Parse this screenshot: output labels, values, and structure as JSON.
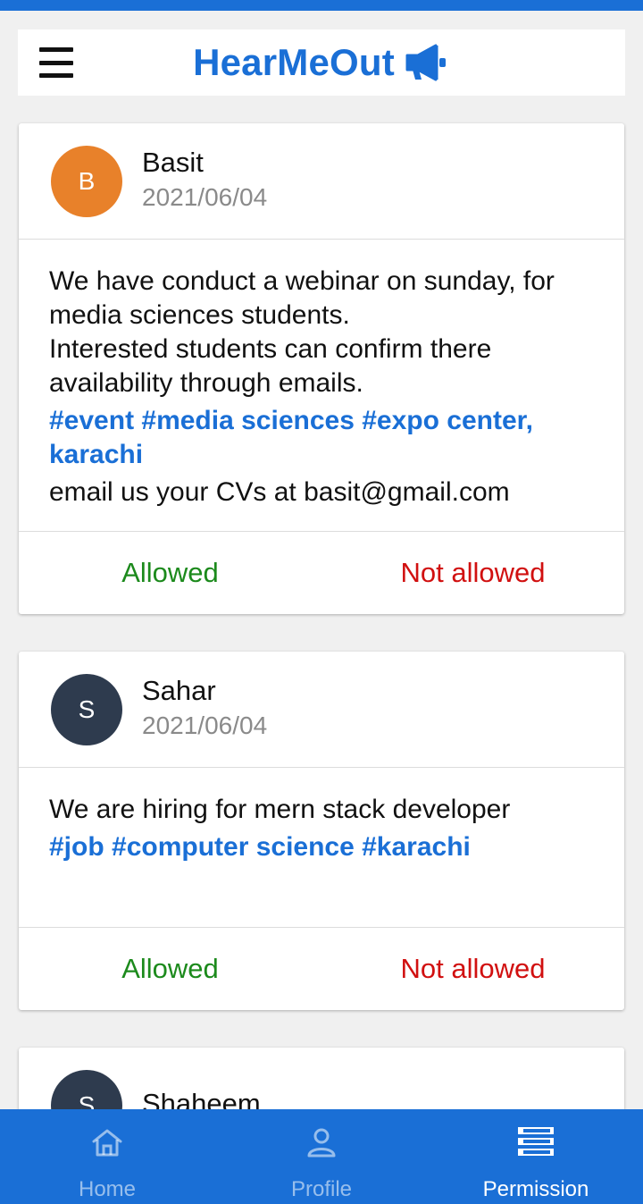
{
  "header": {
    "title": "HearMeOut",
    "icon": "megaphone-icon",
    "menu_icon": "hamburger-menu-icon"
  },
  "colors": {
    "primary": "#1a6fd6",
    "allowed": "#1c8a1c",
    "not_allowed": "#d11010"
  },
  "posts": [
    {
      "avatar_letter": "B",
      "avatar_color": "#e8812a",
      "author": "Basit",
      "date": "2021/06/04",
      "lines": [
        "We have conduct a webinar on sunday, for",
        "media sciences students.",
        "Interested students can confirm there",
        "availability through emails."
      ],
      "tags": "#event #media sciences #expo center, karachi",
      "footer_line": "email us your CVs at basit@gmail.com",
      "allow_label": "Allowed",
      "deny_label": "Not allowed"
    },
    {
      "avatar_letter": "S",
      "avatar_color": "#2e3b4e",
      "author": "Sahar",
      "date": "2021/06/04",
      "lines": [
        "We are hiring for mern stack developer"
      ],
      "tags": "#job #computer science #karachi",
      "allow_label": "Allowed",
      "deny_label": "Not allowed"
    },
    {
      "avatar_letter": "S",
      "avatar_color": "#2e3b4e",
      "author": "Shaheem"
    }
  ],
  "bottom_nav": {
    "items": [
      {
        "label": "Home",
        "icon": "home-icon",
        "active": false
      },
      {
        "label": "Profile",
        "icon": "profile-icon",
        "active": false
      },
      {
        "label": "Permission",
        "icon": "permission-icon",
        "active": true
      }
    ]
  }
}
